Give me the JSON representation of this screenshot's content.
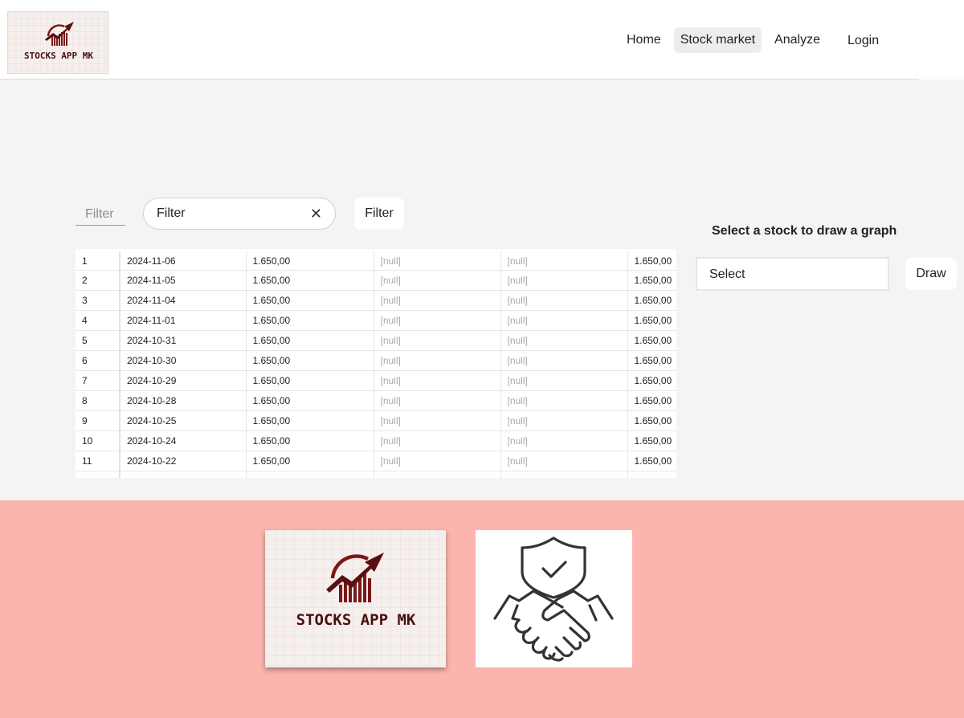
{
  "brand": {
    "logo_text": "STOCKS APP MK",
    "accent": "#6b1a1a"
  },
  "nav": {
    "items": [
      {
        "label": "Home"
      },
      {
        "label": "Stock market",
        "active": true
      },
      {
        "label": "Analyze"
      }
    ],
    "login_label": "Login"
  },
  "filter": {
    "label": "Filter",
    "input_value": "Filter",
    "button_label": "Filter"
  },
  "table": {
    "rows": [
      [
        "1",
        "2024-11-06",
        "1.650,00",
        "[null]",
        "[null]",
        "1.650,00"
      ],
      [
        "2",
        "2024-11-05",
        "1.650,00",
        "[null]",
        "[null]",
        "1.650,00"
      ],
      [
        "3",
        "2024-11-04",
        "1.650,00",
        "[null]",
        "[null]",
        "1.650,00"
      ],
      [
        "4",
        "2024-11-01",
        "1.650,00",
        "[null]",
        "[null]",
        "1.650,00"
      ],
      [
        "5",
        "2024-10-31",
        "1.650,00",
        "[null]",
        "[null]",
        "1.650,00"
      ],
      [
        "6",
        "2024-10-30",
        "1.650,00",
        "[null]",
        "[null]",
        "1.650,00"
      ],
      [
        "7",
        "2024-10-29",
        "1.650,00",
        "[null]",
        "[null]",
        "1.650,00"
      ],
      [
        "8",
        "2024-10-28",
        "1.650,00",
        "[null]",
        "[null]",
        "1.650,00"
      ],
      [
        "9",
        "2024-10-25",
        "1.650,00",
        "[null]",
        "[null]",
        "1.650,00"
      ],
      [
        "10",
        "2024-10-24",
        "1.650,00",
        "[null]",
        "[null]",
        "1.650,00"
      ],
      [
        "11",
        "2024-10-22",
        "1.650,00",
        "[null]",
        "[null]",
        "1.650,00"
      ],
      [
        "",
        "",
        "",
        "",
        "",
        ""
      ]
    ]
  },
  "graph_panel": {
    "title": "Select a stock to draw a graph",
    "select_value": "Select",
    "draw_label": "Draw"
  },
  "colors": {
    "footer_bg": "#fbb4ae",
    "page_bg": "#f4f4f4"
  }
}
